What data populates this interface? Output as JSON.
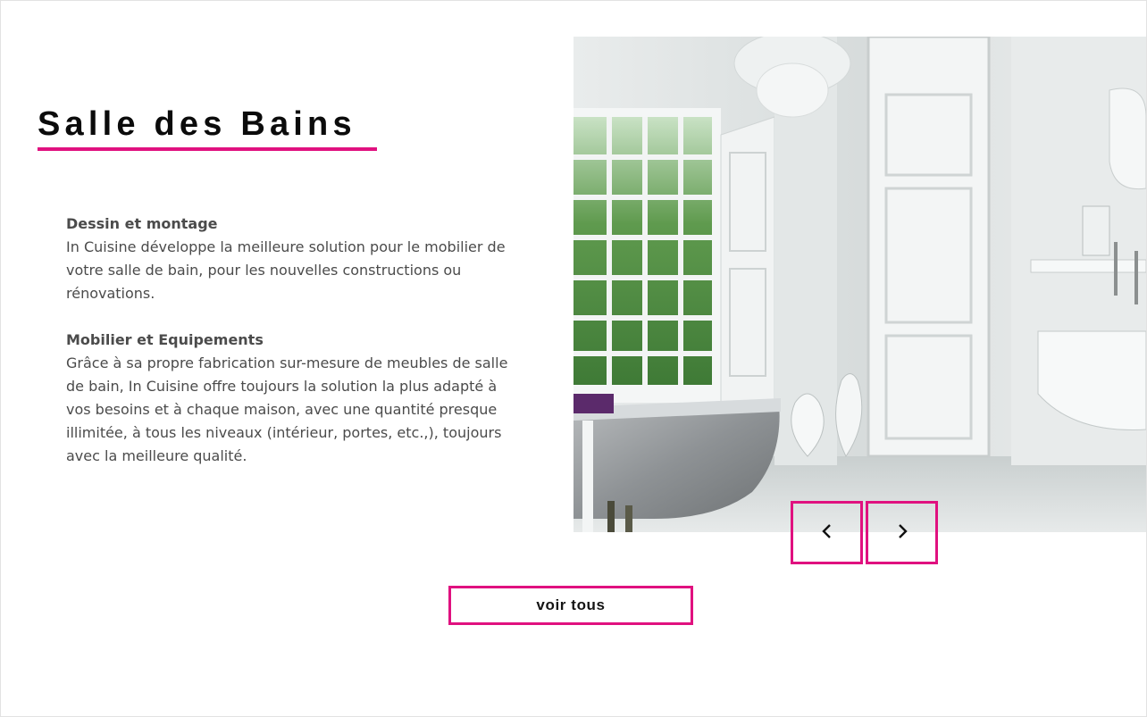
{
  "section": {
    "title": "Salle des Bains"
  },
  "blocks": [
    {
      "heading": "Dessin et montage",
      "text": "In Cuisine développe la meilleure solution pour le mobilier de votre salle de bain, pour les nouvelles constructions ou rénovations."
    },
    {
      "heading": "Mobilier et Equipements",
      "text": "Grâce à sa propre fabrication sur-mesure de meubles de salle de bain, In Cuisine offre toujours la solution la plus adapté à vos besoins et à chaque maison, avec une quantité presque illimitée, à tous les niveaux (intérieur, portes, etc.,), toujours avec la meilleure qualité."
    }
  ],
  "carousel": {
    "prev_icon": "chevron-left-icon",
    "next_icon": "chevron-right-icon"
  },
  "cta": {
    "label": "voir tous"
  },
  "colors": {
    "accent": "#e0117f",
    "text": "#4b4b4b",
    "title": "#0b0b0b"
  }
}
